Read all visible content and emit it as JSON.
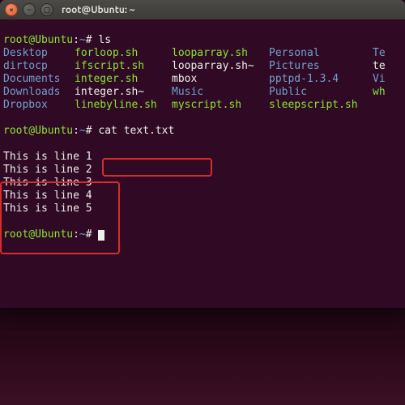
{
  "title": "root@Ubuntu: ~",
  "prompt": {
    "userhost": "root@Ubuntu",
    "path": "~",
    "sep": ":",
    "hash": "#"
  },
  "cmd_ls": "ls",
  "cmd_cat": "cat text.txt",
  "ls": {
    "rows": [
      {
        "c1": {
          "t": "Desktop",
          "k": "dir"
        },
        "c2": {
          "t": "forloop.sh",
          "k": "exec"
        },
        "c3": {
          "t": "looparray.sh",
          "k": "exec"
        },
        "c4": {
          "t": "Personal",
          "k": "dir"
        },
        "c5": {
          "t": "Te",
          "k": "dir"
        }
      },
      {
        "c1": {
          "t": "dirtocp",
          "k": "dir"
        },
        "c2": {
          "t": "ifscript.sh",
          "k": "exec"
        },
        "c3": {
          "t": "looparray.sh~",
          "k": "normal"
        },
        "c4": {
          "t": "Pictures",
          "k": "dir"
        },
        "c5": {
          "t": "te",
          "k": "normal"
        }
      },
      {
        "c1": {
          "t": "Documents",
          "k": "dir"
        },
        "c2": {
          "t": "integer.sh",
          "k": "exec"
        },
        "c3": {
          "t": "mbox",
          "k": "normal"
        },
        "c4": {
          "t": "pptpd-1.3.4",
          "k": "dir"
        },
        "c5": {
          "t": "Vi",
          "k": "dir"
        }
      },
      {
        "c1": {
          "t": "Downloads",
          "k": "dir"
        },
        "c2": {
          "t": "integer.sh~",
          "k": "normal"
        },
        "c3": {
          "t": "Music",
          "k": "dir"
        },
        "c4": {
          "t": "Public",
          "k": "dir"
        },
        "c5": {
          "t": "wh",
          "k": "exec"
        }
      },
      {
        "c1": {
          "t": "Dropbox",
          "k": "dir"
        },
        "c2": {
          "t": "linebyline.sh",
          "k": "exec"
        },
        "c3": {
          "t": "myscript.sh",
          "k": "exec"
        },
        "c4": {
          "t": "sleepscript.sh",
          "k": "exec"
        },
        "c5": {
          "t": "",
          "k": "normal"
        }
      }
    ]
  },
  "output_lines": [
    "This is line 1",
    "This is line 2",
    "This is line 3",
    "This is line 4",
    "This is line 5"
  ]
}
